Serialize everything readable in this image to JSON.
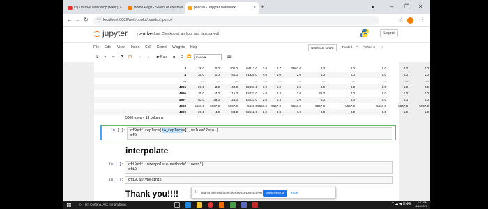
{
  "browser": {
    "tabs": [
      {
        "label": "(1) Dataset workshop (Meet)",
        "color": "#e53935"
      },
      {
        "label": "Home Page - Select or create a",
        "color": "#f57c00"
      },
      {
        "label": "pandas - Jupyter Notebook",
        "color": "#f9a825"
      }
    ],
    "new_tab": "+",
    "url": "localhost:8889/notebooks/pandas.ipynb#"
  },
  "jupyter": {
    "brand": "jupyter",
    "notebook_name": "pandas",
    "checkpoint": "Last Checkpoint: an hour ago (autosaved)",
    "logout": "Logout",
    "menu": [
      "File",
      "Edit",
      "View",
      "Insert",
      "Cell",
      "Kernel",
      "Widgets",
      "Help"
    ],
    "notebook_saved": "Notebook saved",
    "trusted": "Trusted",
    "kernel": "Python 3",
    "run_label": "Run",
    "cell_type": "Code"
  },
  "table": {
    "rows": [
      [
        "3",
        "26.0",
        "0.0",
        "100.0",
        "94112.0",
        "1.0",
        "2.7",
        "5667.0",
        "0.0",
        "0.0",
        "0.0",
        "0.0",
        "0.0"
      ],
      [
        "4",
        "30.0",
        "0.0",
        "40.0",
        "51330.0",
        "4.0",
        "1.0",
        "2.0",
        "0.0",
        "0.0",
        "0.0",
        "0.0",
        "1.0"
      ],
      [
        "...",
        "...",
        "...",
        "...",
        "...",
        "...",
        "...",
        "...",
        "...",
        "...",
        "...",
        "...",
        "..."
      ],
      [
        "4995",
        "26.0",
        "3.0",
        "40.0",
        "92697.0",
        "1.0",
        "1.9",
        "3.0",
        "0.0",
        "0.0",
        "0.0",
        "1.0",
        "0.0"
      ],
      [
        "4996",
        "30.0",
        "4.0",
        "15.0",
        "92037.0",
        "4.0",
        "0.4",
        "1.0",
        "85.0",
        "0.0",
        "0.0",
        "1.0",
        "0.0"
      ],
      [
        "4997",
        "63.0",
        "39.0",
        "24.0",
        "93023.0",
        "2.0",
        "0.3",
        "3.0",
        "0.0",
        "0.0",
        "0.0",
        "0.0",
        "0.0"
      ],
      [
        "4998",
        "5667.0",
        "5667.0",
        "5667.0",
        "5667.0",
        "5667.0",
        "5667.0",
        "5667.0",
        "5667.0",
        "5667.0",
        "5667.0",
        "5667.0",
        "5667.0"
      ],
      [
        "4999",
        "28.0",
        "4.0",
        "83.0",
        "92612.0",
        "3.0",
        "0.8",
        "1.0",
        "0.0",
        "0.0",
        "0.0",
        "1.0",
        "1.0"
      ]
    ],
    "shape": "5000 rows × 13 columns"
  },
  "cells": [
    {
      "prompt": "In [ ]:",
      "line1_pre": "df3=df.replace(",
      "line1_hl": "to_replace",
      "line1_post": "=[],value='Zero')",
      "line2": "df3"
    },
    {
      "prompt": "In [ ]:",
      "line1": "df10=df.interpolate(method='linear')",
      "line2": "df10"
    },
    {
      "prompt": "In [ ]:",
      "line1": "df10.astype(int)"
    }
  ],
  "headings": {
    "interpolate": "interpolate",
    "thanks": "Thank you!!!!"
  },
  "share_bar": {
    "text": "teams.microsoft.com is sharing your screen.",
    "stop": "Stop sharing",
    "hide": "Hide"
  },
  "taskbar": {
    "search": "I'm Cortana. Ask me anything.",
    "time": "6:47 PM",
    "date": "4/10/2021"
  }
}
